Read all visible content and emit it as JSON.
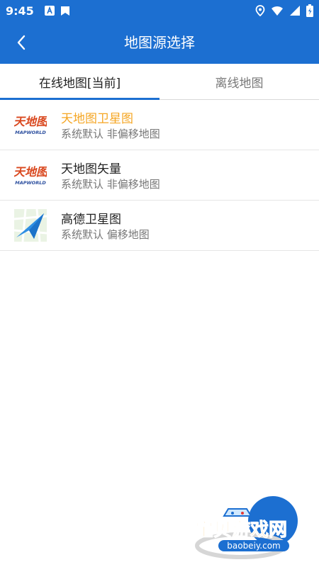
{
  "status_bar": {
    "time": "9:45",
    "icons": [
      "app-icon",
      "book-icon",
      "location-icon",
      "wifi-icon",
      "signal-icon",
      "battery-icon"
    ]
  },
  "app_bar": {
    "title": "地图源选择",
    "back_icon": "chevron-left-icon"
  },
  "tabs": [
    {
      "label": "在线地图[当前]",
      "active": true
    },
    {
      "label": "离线地图",
      "active": false
    }
  ],
  "list": [
    {
      "title": "天地图卫星图",
      "subtitle": "系统默认 非偏移地图",
      "icon": "tianditu-logo",
      "logo_text": "天地图",
      "logo_sub": "MAPWORLD",
      "selected": true
    },
    {
      "title": "天地图矢量",
      "subtitle": "系统默认 非偏移地图",
      "icon": "tianditu-logo",
      "logo_text": "天地图",
      "logo_sub": "MAPWORLD",
      "selected": false
    },
    {
      "title": "高德卫星图",
      "subtitle": "系统默认 偏移地图",
      "icon": "amap-logo",
      "selected": false
    }
  ],
  "watermark": {
    "main": "宝贝游戏网",
    "url": "baobeiy.com"
  },
  "colors": {
    "primary": "#1c6fd1",
    "selected": "#f5a623",
    "logo_red": "#d9481f"
  }
}
